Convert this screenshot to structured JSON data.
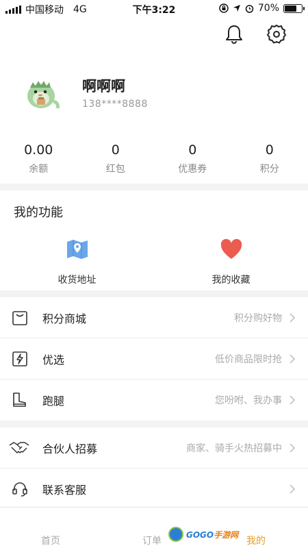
{
  "status_bar": {
    "carrier": "中国移动",
    "network": "4G",
    "time": "下午3:22",
    "battery": "70%",
    "battery_level": 0.7
  },
  "profile": {
    "name": "啊啊啊",
    "phone": "138****8888"
  },
  "stats": [
    {
      "value": "0.00",
      "label": "余额"
    },
    {
      "value": "0",
      "label": "红包"
    },
    {
      "value": "0",
      "label": "优惠券"
    },
    {
      "value": "0",
      "label": "积分"
    }
  ],
  "functions": {
    "title": "我的功能",
    "items": [
      {
        "label": "收货地址",
        "icon": "map-pin-icon"
      },
      {
        "label": "我的收藏",
        "icon": "heart-icon"
      }
    ]
  },
  "list": [
    {
      "label": "积分商城",
      "hint": "积分购好物",
      "icon": "shopping-bag-icon"
    },
    {
      "label": "优选",
      "hint": "低价商品限时抢",
      "icon": "lightning-icon"
    },
    {
      "label": "跑腿",
      "hint": "您吩咐、我办事",
      "icon": "boot-icon"
    },
    {
      "label": "合伙人招募",
      "hint": "商家、骑手火热招募中",
      "icon": "handshake-icon"
    },
    {
      "label": "联系客服",
      "hint": "",
      "icon": "headset-icon"
    }
  ],
  "tabs": [
    {
      "label": "首页",
      "active": false
    },
    {
      "label": "订单",
      "active": false
    },
    {
      "label": "我的",
      "active": true
    }
  ],
  "watermark": {
    "text_a": "GOGO",
    "text_b": "手游网"
  },
  "colors": {
    "accent": "#e0a12b",
    "heart": "#ec5b4f",
    "map": "#6aa6e8"
  }
}
